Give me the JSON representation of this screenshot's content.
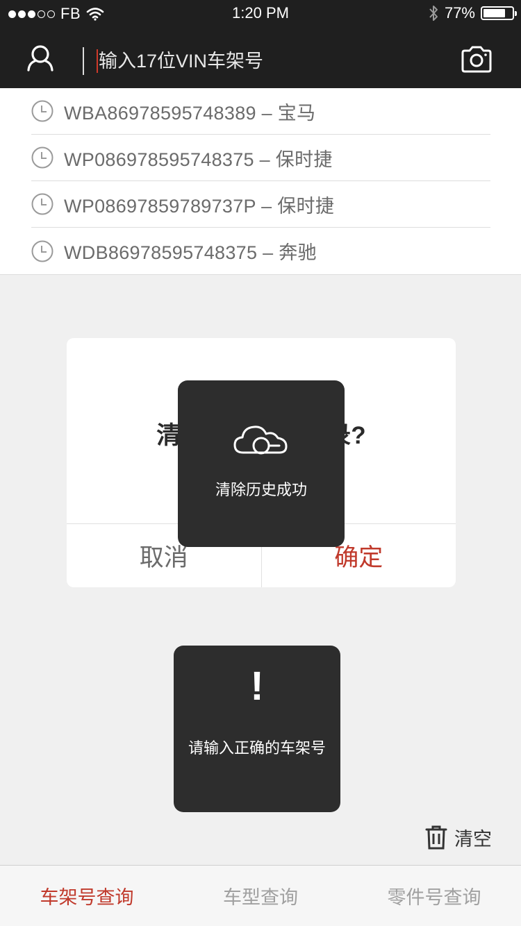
{
  "status_bar": {
    "carrier": "FB",
    "time": "1:20 PM",
    "battery_percent": "77%",
    "battery_level": 0.77
  },
  "search": {
    "placeholder": "输入17位VIN车架号"
  },
  "history": [
    {
      "vin": "WBA86978595748389",
      "brand": "宝马",
      "label": "WBA86978595748389 – 宝马"
    },
    {
      "vin": "WP086978595748375",
      "brand": "保时捷",
      "label": "WP086978595748375 – 保时捷"
    },
    {
      "vin": "WP08697859789737P",
      "brand": "保时捷",
      "label": "WP08697859789737P – 保时捷"
    },
    {
      "vin": "WDB86978595748375",
      "brand": "奔驰",
      "label": "WDB86978595748375 – 奔驰"
    }
  ],
  "dialog": {
    "title": "清除查询历史记录?",
    "cancel": "取消",
    "confirm": "确定"
  },
  "toasts": {
    "success": {
      "icon": "cloud-check-icon",
      "text": "清除历史成功"
    },
    "error": {
      "icon": "!",
      "text": "请输入正确的车架号"
    }
  },
  "clear_button": {
    "label": "清空",
    "icon": "trash-icon"
  },
  "tabs": [
    {
      "label": "车架号查询",
      "active": true
    },
    {
      "label": "车型查询",
      "active": false
    },
    {
      "label": "零件号查询",
      "active": false
    }
  ],
  "colors": {
    "header_bg": "#1f1f1f",
    "accent": "#c0392b",
    "toast_bg": "#2d2d2d",
    "page_bg": "#f0f0f0"
  }
}
